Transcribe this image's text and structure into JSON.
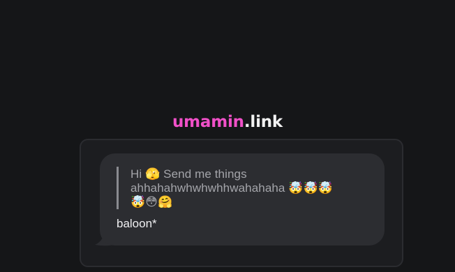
{
  "brand": {
    "name": "umamin",
    "tld": ".link"
  },
  "message": {
    "quote_line1": "Hi 🫣 Send me things",
    "quote_line2": "ahhahahwhwhwhhwahahaha 🤯🤯🤯",
    "quote_line3": "🤯😳🤗",
    "reply": "baloon*"
  },
  "colors": {
    "background": "#151618",
    "brand_accent": "#f050c8",
    "bubble": "#2c2d31",
    "card": "#1c1d20"
  }
}
